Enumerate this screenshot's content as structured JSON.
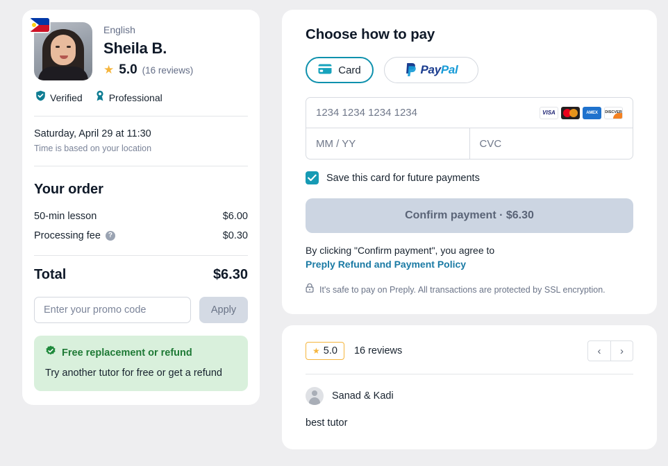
{
  "tutor": {
    "language": "English",
    "name": "Sheila B.",
    "rating": "5.0",
    "reviews_label": "(16 reviews)",
    "flag_icon": "philippines-flag-icon",
    "badges": [
      {
        "icon": "shield-check-icon",
        "label": "Verified"
      },
      {
        "icon": "award-ribbon-icon",
        "label": "Professional"
      }
    ]
  },
  "schedule": {
    "datetime": "Saturday, April 29 at 11:30",
    "note": "Time is based on your location"
  },
  "order": {
    "title": "Your order",
    "items": [
      {
        "label": "50-min lesson",
        "price": "$6.00",
        "has_tooltip": false
      },
      {
        "label": "Processing fee",
        "price": "$0.30",
        "has_tooltip": true
      }
    ],
    "total_label": "Total",
    "total_value": "$6.30"
  },
  "promo": {
    "placeholder": "Enter your promo code",
    "value": "",
    "apply_label": "Apply"
  },
  "refund": {
    "icon": "check-badge-icon",
    "title": "Free replacement or refund",
    "subtitle": "Try another tutor for free or get a refund"
  },
  "payment": {
    "title": "Choose how to pay",
    "methods": [
      {
        "id": "card",
        "label": "Card",
        "icon": "credit-card-icon",
        "selected": true
      },
      {
        "id": "paypal",
        "label": "PayPal",
        "icon": "paypal-logo-icon",
        "selected": false,
        "word_pay": "Pay",
        "word_pal": "Pal"
      }
    ],
    "card_number_placeholder": "1234 1234 1234 1234",
    "card_number_value": "",
    "expiry_placeholder": "MM / YY",
    "expiry_value": "",
    "cvc_placeholder": "CVC",
    "cvc_value": "",
    "brands": [
      {
        "id": "visa",
        "label": "VISA"
      },
      {
        "id": "mastercard",
        "label": ""
      },
      {
        "id": "amex",
        "label": "AMEX"
      },
      {
        "id": "discover",
        "label": "DISCVER"
      }
    ],
    "save_card_label": "Save this card for future payments",
    "save_card_checked": true,
    "confirm_label": "Confirm payment · $6.30",
    "agree_text": "By clicking \"Confirm payment\", you agree to",
    "agree_link": "Preply Refund and Payment Policy",
    "ssl_icon": "lock-icon",
    "ssl_text": "It's safe to pay on Preply. All transactions are protected by SSL encryption."
  },
  "reviews": {
    "rating": "5.0",
    "count_label": "16 reviews",
    "prev_icon": "chevron-left-icon",
    "next_icon": "chevron-right-icon",
    "items": [
      {
        "author": "Sanad & Kadi",
        "text": "best tutor",
        "avatar_icon": "user-avatar-icon"
      }
    ]
  },
  "colors": {
    "page_bg": "#eeeef0",
    "accent_teal": "#0f91ad",
    "checkbox_teal": "#169ab4",
    "link_blue": "#1a7aa4",
    "star_gold": "#f5b53d",
    "green_bg": "#d9f0dc",
    "green_text": "#1f7a36",
    "text_dark": "#17222e",
    "disabled_btn": "#ccd5e2"
  }
}
